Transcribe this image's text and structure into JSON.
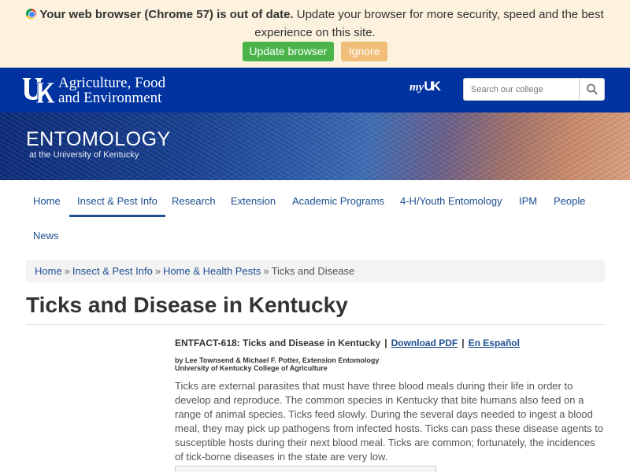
{
  "banner": {
    "bold_text": "Your web browser (Chrome 57) is out of date.",
    "text": " Update your browser for more security, speed and the best experience on this site.",
    "update_label": "Update browser",
    "ignore_label": "Ignore"
  },
  "header": {
    "college_line1": "Agriculture, Food",
    "college_line2": "and Environment",
    "myuk_my": "my",
    "myuk_uk": "UK",
    "search_placeholder": "Search our college"
  },
  "hero": {
    "title": "ENTOMOLOGY",
    "subtitle": "at the University of Kentucky"
  },
  "nav": {
    "items": [
      {
        "label": "Home"
      },
      {
        "label": "Insect & Pest Info"
      },
      {
        "label": "Research"
      },
      {
        "label": "Extension"
      },
      {
        "label": "Academic Programs"
      },
      {
        "label": "4-H/Youth Entomology"
      },
      {
        "label": "IPM"
      },
      {
        "label": "People"
      },
      {
        "label": "News"
      }
    ]
  },
  "breadcrumb": {
    "items": [
      "Home",
      "Insect & Pest Info",
      "Home & Health Pests"
    ],
    "current": "Ticks and Disease",
    "separator": "»"
  },
  "page": {
    "title": "Ticks and Disease in Kentucky",
    "fact_title": "ENTFACT-618: Ticks and Disease in Kentucky",
    "pipe": "|",
    "download_label": "Download PDF",
    "spanish_label": "En Español",
    "authors_line1": "by Lee Townsend & Michael F. Potter, Extension Entomology",
    "authors_line2": "University of Kentucky College of Agriculture",
    "body": "Ticks are external parasites that must have three blood meals during their life in order to develop and reproduce. The common species in Kentucky that bite humans also feed on a range of animal species. Ticks feed slowly. During the several days needed to ingest a blood meal, they may pick up pathogens from infected hosts. Ticks can pass these disease agents to susceptible hosts during their next blood meal. Ticks are common; fortunately, the incidences of tick-borne diseases in the state are very low."
  },
  "colors": {
    "uk_blue": "#0033a0",
    "link_blue": "#1d4f91",
    "banner_bg": "#fcf2dd",
    "update_green": "#4ab44a",
    "ignore_orange": "#f0be78"
  },
  "icons": {
    "browser": "chrome-icon",
    "logo": "uk-logo-icon",
    "search": "search-icon"
  }
}
